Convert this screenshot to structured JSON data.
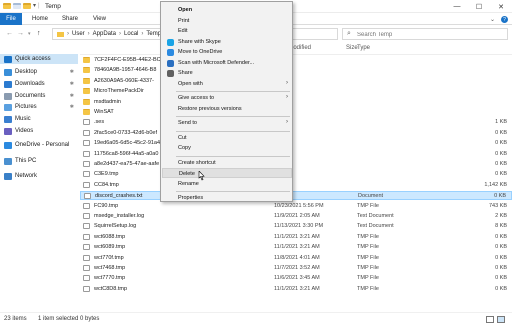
{
  "titlebar": {
    "title": "Temp",
    "buttons": {
      "minimize": "—",
      "maximize": "☐",
      "close": "✕"
    }
  },
  "ribbon": {
    "tabs": [
      "File",
      "Home",
      "Share",
      "View"
    ],
    "expand": "⌄",
    "help": "?"
  },
  "address": {
    "crumbs": [
      "User",
      "AppData",
      "Local",
      "Temp"
    ],
    "search_placeholder": "Search Temp"
  },
  "nav": {
    "items": [
      {
        "label": "Quick access",
        "icon": "star-icon",
        "color": "#1a73c8",
        "active": true
      },
      {
        "label": "Desktop",
        "icon": "desktop-icon",
        "color": "#3a8fd9",
        "pinned": true
      },
      {
        "label": "Downloads",
        "icon": "download-icon",
        "color": "#2b7bd0",
        "pinned": true
      },
      {
        "label": "Documents",
        "icon": "documents-icon",
        "color": "#8a9bb0",
        "pinned": true
      },
      {
        "label": "Pictures",
        "icon": "pictures-icon",
        "color": "#5aa0e0",
        "pinned": true
      },
      {
        "label": "Music",
        "icon": "music-icon",
        "color": "#3a7fd0"
      },
      {
        "label": "Videos",
        "icon": "videos-icon",
        "color": "#6a5fc0"
      },
      {
        "label": "OneDrive - Personal",
        "icon": "onedrive-icon",
        "color": "#2b8ae0"
      },
      {
        "label": "This PC",
        "icon": "computer-icon",
        "color": "#4a90d0"
      },
      {
        "label": "Network",
        "icon": "network-icon",
        "color": "#3a80c8"
      }
    ]
  },
  "columns": {
    "date": "Date modified",
    "type": "Type",
    "size": "Size"
  },
  "files": [
    {
      "name": "7CF2F4FC-E95B-44E2-BC",
      "kind": "folder",
      "date": "",
      "type": "",
      "size": ""
    },
    {
      "name": "78460A9B-1957-4646-B8",
      "kind": "folder",
      "date": "",
      "type": "",
      "size": ""
    },
    {
      "name": "A2630A9A5-060E-4337-",
      "kind": "folder",
      "date": "",
      "type": "",
      "size": ""
    },
    {
      "name": "MicroThemePackDir",
      "kind": "folder",
      "date": "",
      "type": "",
      "size": ""
    },
    {
      "name": "msdtadmin",
      "kind": "folder",
      "date": "",
      "type": "",
      "size": ""
    },
    {
      "name": "WinSAT",
      "kind": "folder",
      "date": "",
      "type": "",
      "size": ""
    },
    {
      "name": ".ses",
      "kind": "file",
      "date": "",
      "type": "",
      "size": "1 KB"
    },
    {
      "name": "2fac5ce0-0733-42d6-b0ef",
      "kind": "file",
      "date": "",
      "type": "",
      "size": "0 KB"
    },
    {
      "name": "19ed6a05-6d5c-45c2-91a4",
      "kind": "file",
      "date": "",
      "type": "",
      "size": "0 KB"
    },
    {
      "name": "11756ca8-596f-44a5-a0a0",
      "kind": "file",
      "date": "",
      "type": "",
      "size": "0 KB"
    },
    {
      "name": "a8e2d437-ea75-47ae-aafe",
      "kind": "file",
      "date": "",
      "type": "",
      "size": "0 KB"
    },
    {
      "name": "C3E9.tmp",
      "kind": "file",
      "date": "",
      "type": "",
      "size": "0 KB"
    },
    {
      "name": "CC84.tmp",
      "kind": "file",
      "date": "",
      "type": "",
      "size": "1,142 KB"
    },
    {
      "name": "discord_crashes.txt",
      "kind": "file",
      "date": "",
      "type": "Document",
      "size": "0 KB",
      "selected": true
    },
    {
      "name": "FC90.tmp",
      "kind": "file",
      "date": "10/23/2021 5:56 PM",
      "type": "TMP File",
      "size": "743 KB"
    },
    {
      "name": "msedge_installer.log",
      "kind": "file",
      "date": "11/9/2021 2:05 AM",
      "type": "Text Document",
      "size": "2 KB"
    },
    {
      "name": "SquirrelSetup.log",
      "kind": "file",
      "date": "11/13/2021 3:30 PM",
      "type": "Text Document",
      "size": "8 KB"
    },
    {
      "name": "wct6088.tmp",
      "kind": "file",
      "date": "11/1/2021 3:21 AM",
      "type": "TMP File",
      "size": "0 KB"
    },
    {
      "name": "wct6089.tmp",
      "kind": "file",
      "date": "11/1/2021 3:21 AM",
      "type": "TMP File",
      "size": "0 KB"
    },
    {
      "name": "wct770f.tmp",
      "kind": "file",
      "date": "11/8/2021 4:01 AM",
      "type": "TMP File",
      "size": "0 KB"
    },
    {
      "name": "wct7468.tmp",
      "kind": "file",
      "date": "11/7/2021 3:52 AM",
      "type": "TMP File",
      "size": "0 KB"
    },
    {
      "name": "wct7770.tmp",
      "kind": "file",
      "date": "11/6/2021 3:45 AM",
      "type": "TMP File",
      "size": "0 KB"
    },
    {
      "name": "wctC8D8.tmp",
      "kind": "file",
      "date": "11/1/2021 3:21 AM",
      "type": "TMP File",
      "size": "0 KB"
    }
  ],
  "status": {
    "count": "23 items",
    "selection": "1 item selected 0 bytes"
  },
  "menu": {
    "items": [
      {
        "label": "Open",
        "bold": true
      },
      {
        "label": "Print"
      },
      {
        "label": "Edit"
      },
      {
        "label": "Share with Skype",
        "icon": "skype-icon",
        "icon_color": "#1aa4e6"
      },
      {
        "label": "Move to OneDrive",
        "icon": "onedrive-icon",
        "icon_color": "#2b8ae0"
      },
      {
        "label": "Scan with Microsoft Defender...",
        "icon": "defender-icon",
        "icon_color": "#2a6fc0"
      },
      {
        "label": "Share",
        "icon": "share-icon",
        "icon_color": "#606060"
      },
      {
        "label": "Open with",
        "submenu": true
      },
      {
        "sep": true
      },
      {
        "label": "Give access to",
        "submenu": true
      },
      {
        "label": "Restore previous versions"
      },
      {
        "sep": true
      },
      {
        "label": "Send to",
        "submenu": true
      },
      {
        "sep": true
      },
      {
        "label": "Cut"
      },
      {
        "label": "Copy"
      },
      {
        "sep": true
      },
      {
        "label": "Create shortcut"
      },
      {
        "label": "Delete",
        "hover": true
      },
      {
        "label": "Rename"
      },
      {
        "sep": true
      },
      {
        "label": "Properties"
      }
    ]
  }
}
